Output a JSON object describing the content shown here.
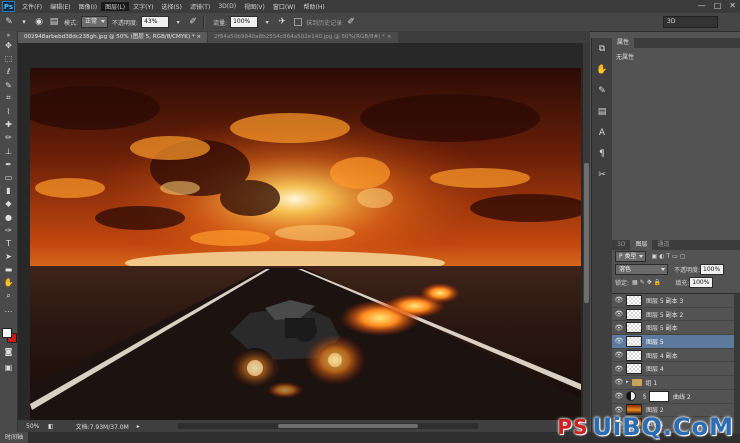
{
  "app": {
    "logo": "Ps",
    "menu": [
      "文件(F)",
      "编辑(E)",
      "图像(I)",
      "图层(L)",
      "文字(Y)",
      "选择(S)",
      "滤镜(T)",
      "3D(D)",
      "视图(V)",
      "窗口(W)",
      "帮助(H)"
    ],
    "active_menu_index": 3,
    "window_controls": [
      "—",
      "□",
      "✕"
    ]
  },
  "options_bar": {
    "mode_label": "模式:",
    "mode_value": "正常",
    "opacity_label": "不透明度:",
    "opacity_value": "43%",
    "flow_label": "流量:",
    "flow_value": "100%",
    "history_label": "抹到历史记录",
    "workspace": "3D"
  },
  "tabs": [
    {
      "label": "002948arbebd38dc238gh.jpg @ 50% (图层 5, RGB/8/CMYK) *",
      "active": true
    },
    {
      "label": "2f84a50b9840a8b2554c864a502e140.jpg @ 50%(RGB/8#) *",
      "active": false
    }
  ],
  "tab_close": "×",
  "status": {
    "zoom": "50%",
    "doc_info": "文档:7.93M/37.0M",
    "arrow": "▸"
  },
  "timeline_tab": "时间轴",
  "properties": {
    "tabs": [
      "属性"
    ],
    "body_text": "无属性"
  },
  "layers_panel": {
    "tabs": [
      "3D",
      "图层",
      "通道"
    ],
    "active_tab_index": 1,
    "filter_label": "P 类型",
    "blend_mode": "溶色",
    "opacity_label": "不透明度:",
    "opacity_value": "100%",
    "lock_label": "锁定:",
    "fill_label": "填充:",
    "fill_value": "100%",
    "layers": [
      {
        "name": "图层 5 副本 3",
        "thumb": "checker",
        "visible": true,
        "selected": false
      },
      {
        "name": "图层 5 副本 2",
        "thumb": "checker",
        "visible": true,
        "selected": false
      },
      {
        "name": "图层 5 副本",
        "thumb": "checker",
        "visible": true,
        "selected": false
      },
      {
        "name": "图层 5",
        "thumb": "checker",
        "visible": true,
        "selected": true
      },
      {
        "name": "图层 4 副本",
        "thumb": "checker",
        "visible": true,
        "selected": false
      },
      {
        "name": "图层 4",
        "thumb": "checker",
        "visible": true,
        "selected": false
      },
      {
        "name": "组 1",
        "thumb": "folder",
        "visible": true,
        "selected": false
      },
      {
        "name": "曲线 2",
        "thumb": "adjust",
        "visible": true,
        "selected": false
      },
      {
        "name": "图层 2",
        "thumb": "sunset",
        "visible": true,
        "selected": false
      },
      {
        "name": "图层 1",
        "thumb": "sunset",
        "visible": true,
        "selected": false
      }
    ]
  },
  "watermark": {
    "lead": "PS",
    "text": "UiBQ.CoM"
  },
  "colors": {
    "foreground": "#ffffff",
    "background": "#c71a1a",
    "selection": "#5d7a9c"
  }
}
